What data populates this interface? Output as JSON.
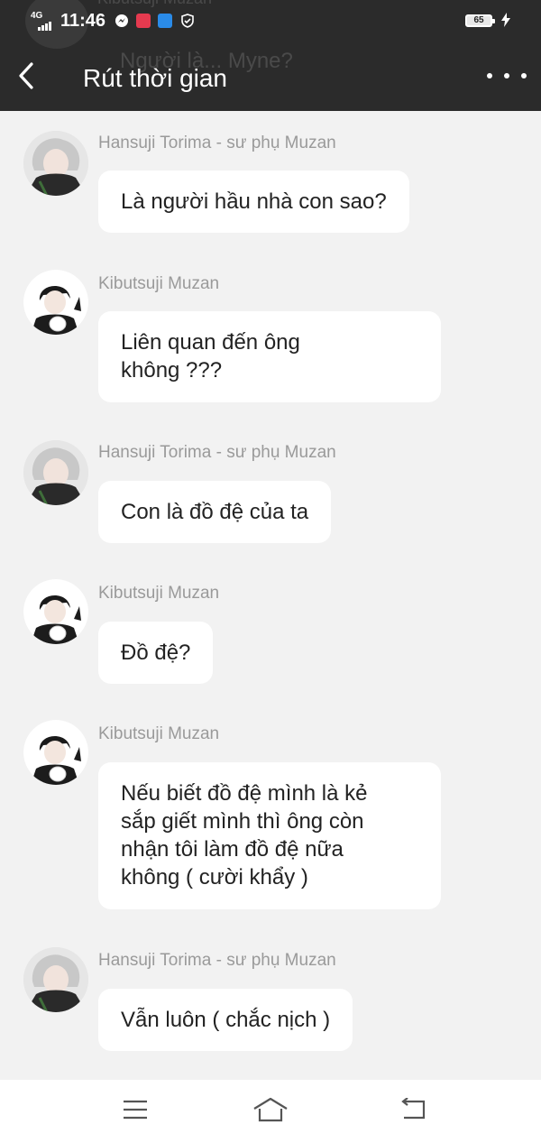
{
  "status_bar": {
    "network": "4G",
    "time": "11:46",
    "battery": "65",
    "icons": [
      "messenger-icon",
      "mangatoon-icon",
      "novel-toon-icon",
      "shield-icon",
      "charging-icon"
    ]
  },
  "header": {
    "title": "Rút thời gian",
    "back_icon": "chevron-left-icon",
    "menu_icon": "more-dots-icon",
    "bg_color": "#2b2b2b",
    "background_ghost": {
      "name": "Kibutsuji Muzan",
      "text": "Người là... Myne?"
    }
  },
  "messages": [
    {
      "name": "Hansuji Torima - sư phụ Muzan",
      "text": "Là người hầu nhà con sao?"
    },
    {
      "name": "Kibutsuji Muzan",
      "text": "Liên quan đến ông\nkhông ???"
    },
    {
      "name": "Hansuji Torima - sư phụ Muzan",
      "text": "Con là đồ đệ của ta"
    },
    {
      "name": "Kibutsuji Muzan",
      "text": "Đồ đệ?"
    },
    {
      "name": "Kibutsuji Muzan",
      "text": "Nếu biết đồ đệ mình là kẻ\nsắp giết mình thì ông còn\nnhận tôi làm đồ đệ nữa\nkhông ( cười khẩy )"
    },
    {
      "name": "Hansuji Torima - sư phụ Muzan",
      "text": "Vẫn luôn ( chắc nịch )"
    }
  ],
  "nav_bar": {
    "icons": [
      "menu-icon",
      "home-icon",
      "back-icon"
    ]
  },
  "colors": {
    "page_bg": "#f2f2f2",
    "bubble_bg": "#ffffff",
    "name_text": "#9a9a9a",
    "message_text": "#222222"
  }
}
